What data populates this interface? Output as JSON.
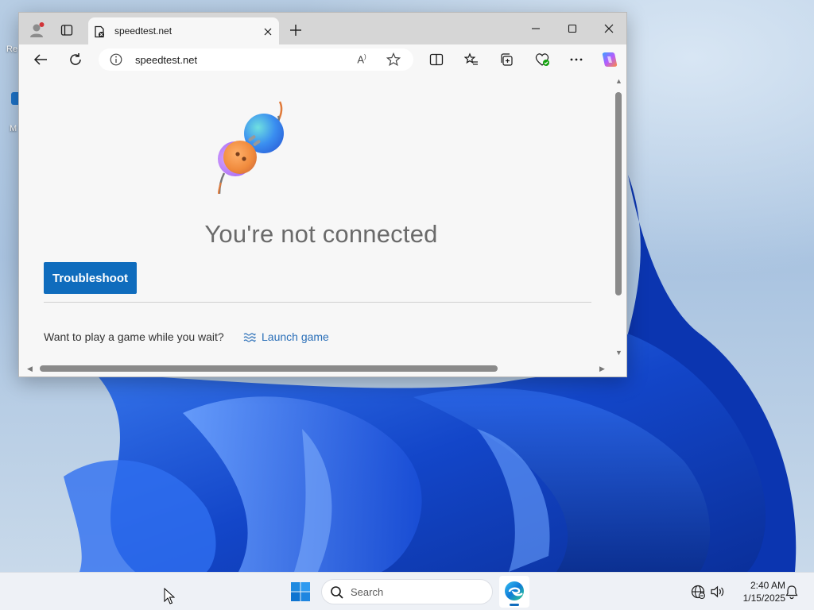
{
  "desktop": {
    "icons": [
      {
        "label": "Re"
      },
      {
        "label": "M"
      }
    ]
  },
  "browser": {
    "tab": {
      "title": "speedtest.net",
      "favicon": "page-error-icon"
    },
    "address": {
      "url": "speedtest.net",
      "info_icon": "info-icon"
    },
    "toolbar_icons": [
      "back-icon",
      "refresh-icon",
      "read-aloud-icon",
      "favorite-star-icon",
      "split-screen-icon",
      "favorites-icon",
      "collections-icon",
      "browser-essentials-icon",
      "more-icon",
      "copilot-icon"
    ],
    "window_controls": [
      "minimize-icon",
      "maximize-icon",
      "close-icon"
    ],
    "page": {
      "heading": "You're not connected",
      "troubleshoot_label": "Troubleshoot",
      "game_prompt": "Want to play a game while you wait?",
      "launch_game_label": "Launch game",
      "illustration": "unplugged-cable-icon"
    }
  },
  "taskbar": {
    "search_label": "Search",
    "time": "2:40 AM",
    "date": "1/15/2025",
    "pinned": [
      "windows-start-icon",
      "edge-icon"
    ],
    "tray": [
      "network-icon",
      "volume-icon",
      "notifications-icon"
    ]
  },
  "colors": {
    "accent": "#0f6cbd",
    "link": "#2a6fb8",
    "heading": "#6a6a6a",
    "wallpaper_blue": "#1a4fd8"
  }
}
